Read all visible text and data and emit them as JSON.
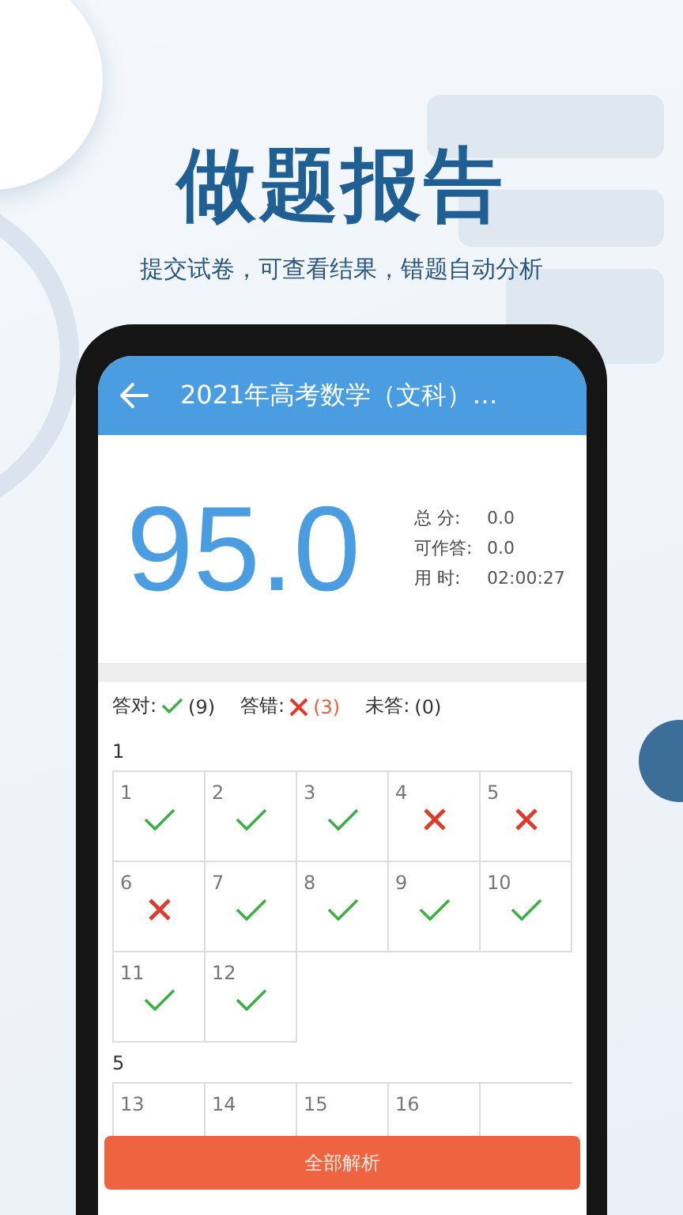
{
  "hero": {
    "title": "做题报告",
    "subtitle": "提交试卷，可查看结果，错题自动分析"
  },
  "header": {
    "title": "2021年高考数学（文科）…"
  },
  "score": "95.0",
  "stats": [
    {
      "label": "总 分:",
      "value": "0.0"
    },
    {
      "label": "可作答:",
      "value": "0.0"
    },
    {
      "label": "用 时:",
      "value": "02:00:27"
    }
  ],
  "legend": [
    {
      "kind": "correct",
      "label": "答对:",
      "count": "(9)"
    },
    {
      "kind": "wrong",
      "label": "答错:",
      "count": "(3)"
    },
    {
      "kind": "unanswered",
      "label": "未答:",
      "count": "(0)"
    }
  ],
  "sections": [
    {
      "title": "1",
      "questions": [
        {
          "number": "1",
          "correct": true
        },
        {
          "number": "2",
          "correct": true
        },
        {
          "number": "3",
          "correct": true
        },
        {
          "number": "4",
          "correct": false
        },
        {
          "number": "5",
          "correct": false
        },
        {
          "number": "6",
          "correct": false
        },
        {
          "number": "7",
          "correct": true
        },
        {
          "number": "8",
          "correct": true
        },
        {
          "number": "9",
          "correct": true
        },
        {
          "number": "10",
          "correct": true
        },
        {
          "number": "11",
          "correct": true
        },
        {
          "number": "12",
          "correct": true
        }
      ]
    },
    {
      "title": "5",
      "questions": [
        {
          "number": "13"
        },
        {
          "number": "14"
        },
        {
          "number": "15"
        },
        {
          "number": "16"
        }
      ]
    }
  ],
  "button": "全部解析"
}
